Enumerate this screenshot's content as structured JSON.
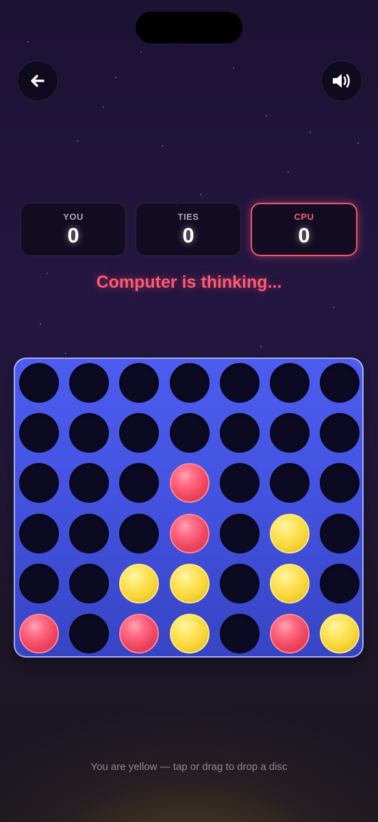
{
  "header": {
    "back_icon": "arrow-left-icon",
    "sound_icon": "speaker-volume-icon"
  },
  "scores": {
    "you": {
      "label": "YOU",
      "value": "0"
    },
    "ties": {
      "label": "TIES",
      "value": "0"
    },
    "cpu": {
      "label": "CPU",
      "value": "0"
    }
  },
  "status": {
    "text": "Computer is thinking..."
  },
  "board": {
    "columns": 7,
    "rows": 6,
    "grid": [
      [
        null,
        null,
        null,
        null,
        null,
        null,
        null
      ],
      [
        null,
        null,
        null,
        null,
        null,
        null,
        null
      ],
      [
        null,
        null,
        null,
        "red",
        null,
        null,
        null
      ],
      [
        null,
        null,
        null,
        "red",
        null,
        "yellow",
        null
      ],
      [
        null,
        null,
        "yellow",
        "yellow",
        null,
        "yellow",
        null
      ],
      [
        "red",
        null,
        "red",
        "yellow",
        null,
        "red",
        "yellow"
      ]
    ]
  },
  "footer": {
    "hint": "You are yellow — tap or drag to drop a disc"
  },
  "colors": {
    "player_disc": "#f7d638",
    "cpu_disc": "#f0465f",
    "board": "#4352de",
    "accent": "#ff5a72"
  }
}
